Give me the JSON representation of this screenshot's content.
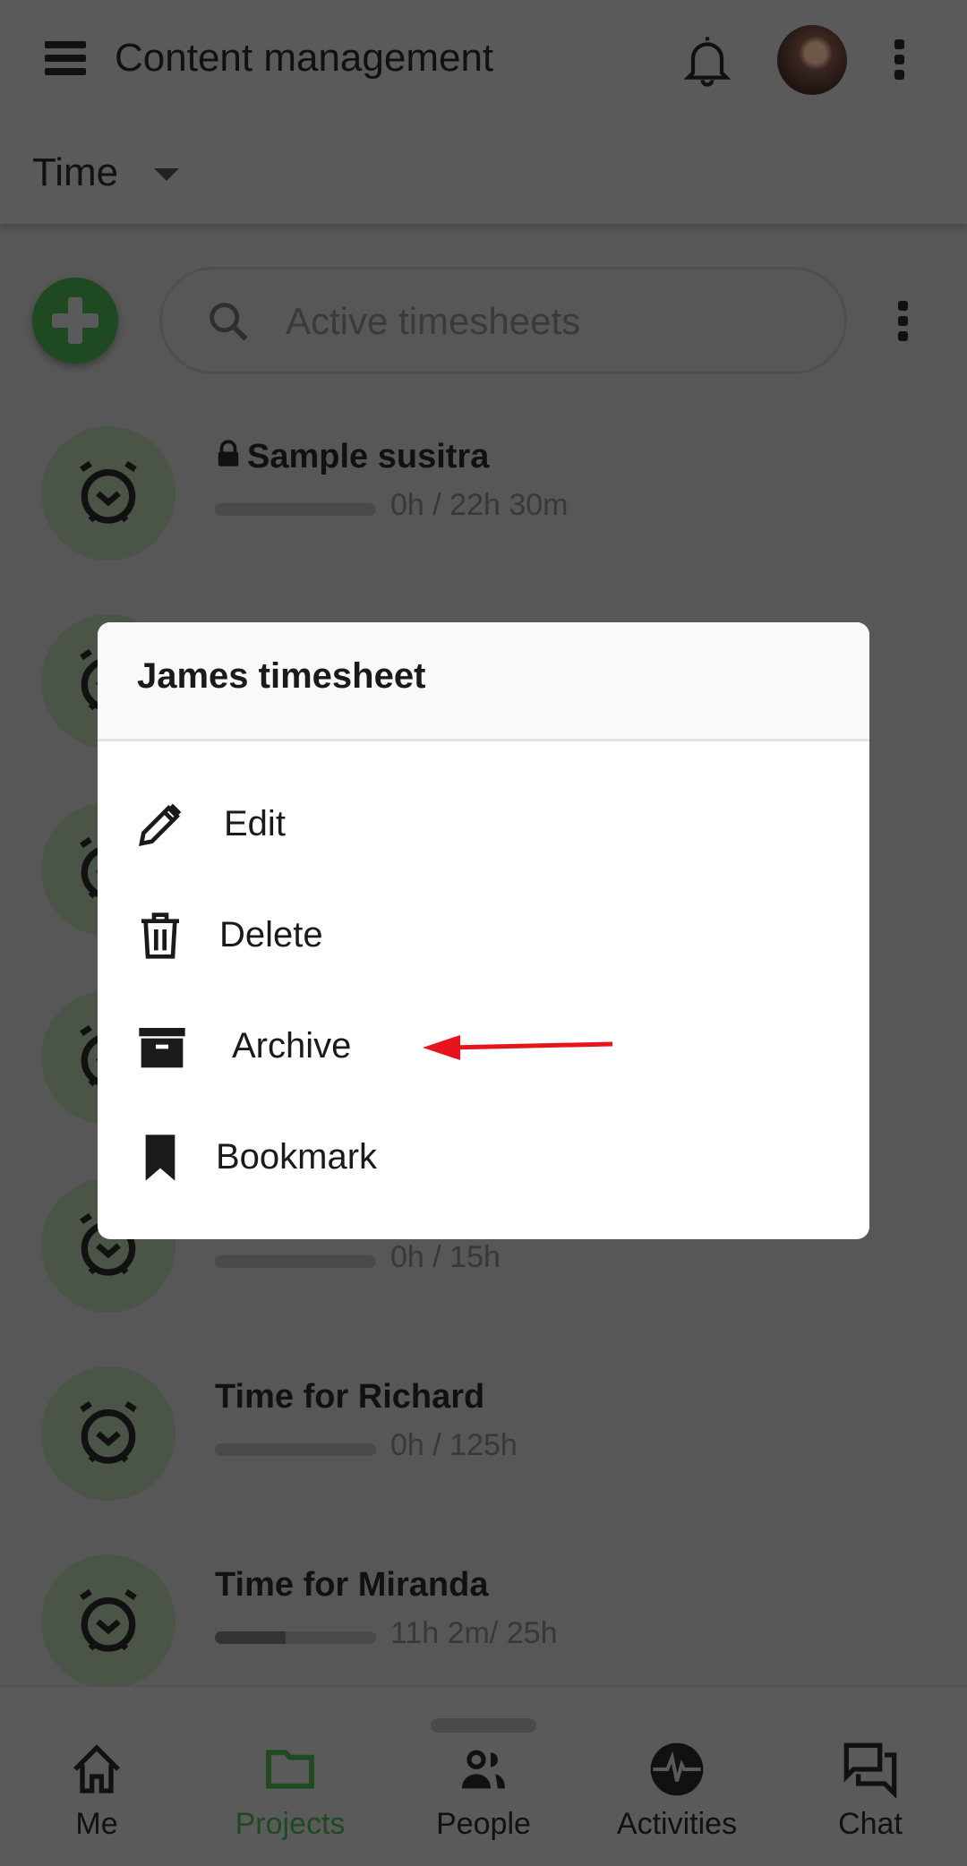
{
  "header": {
    "title": "Content management",
    "section": "Time"
  },
  "search": {
    "placeholder": "Active timesheets"
  },
  "list": [
    {
      "title": "Sample susitra",
      "locked": true,
      "progress_text": "0h / 22h 30m",
      "progress": 0
    },
    {
      "title": "",
      "progress_text": "",
      "progress": 0
    },
    {
      "title": "",
      "progress_text": "",
      "progress": 0
    },
    {
      "title": "",
      "progress_text": "",
      "progress": 0
    },
    {
      "title": "",
      "progress_text": "0h / 15h",
      "progress": 0
    },
    {
      "title": "Time for Richard",
      "progress_text": "0h / 125h",
      "progress": 0
    },
    {
      "title": "Time for Miranda",
      "progress_text": "11h 2m/ 25h",
      "progress": 0.44
    }
  ],
  "dialog": {
    "title": "James timesheet",
    "items": [
      {
        "label": "Edit",
        "icon": "pencil-icon"
      },
      {
        "label": "Delete",
        "icon": "trash-icon"
      },
      {
        "label": "Archive",
        "icon": "archive-box-icon"
      },
      {
        "label": "Bookmark",
        "icon": "bookmark-icon"
      }
    ]
  },
  "nav": {
    "items": [
      {
        "label": "Me"
      },
      {
        "label": "Projects",
        "active": true
      },
      {
        "label": "People"
      },
      {
        "label": "Activities"
      },
      {
        "label": "Chat"
      }
    ]
  },
  "colors": {
    "accent": "#3a8a3c",
    "annotation_arrow": "#e8141b"
  }
}
